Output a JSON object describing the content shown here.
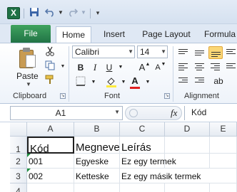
{
  "tabs": {
    "file": "File",
    "home": "Home",
    "insert": "Insert",
    "page_layout": "Page Layout",
    "formulas": "Formula"
  },
  "ribbon": {
    "paste_label": "Paste",
    "clipboard_label": "Clipboard",
    "font_name": "Calibri",
    "font_size": "14",
    "font_label": "Font",
    "alignment_label": "Alignment",
    "bold": "B",
    "italic": "I",
    "underline": "U",
    "grow_font": "A",
    "shrink_font": "A",
    "font_color": "A"
  },
  "formula_bar": {
    "name_box": "A1",
    "fx": "fx",
    "value": "Kód"
  },
  "sheet": {
    "columns": [
      "A",
      "B",
      "C",
      "D",
      "E"
    ],
    "rows": [
      {
        "num": "1",
        "cells": [
          "Kód",
          "Megnevezés",
          "Leírás",
          "",
          ""
        ]
      },
      {
        "num": "2",
        "cells": [
          "001",
          "Egyeske",
          "Ez egy termek",
          "",
          ""
        ]
      },
      {
        "num": "3",
        "cells": [
          "002",
          "Ketteske",
          "Ez egy másik termek",
          "",
          ""
        ]
      },
      {
        "num": "4",
        "cells": [
          "",
          "",
          "",
          "",
          ""
        ]
      }
    ]
  },
  "colors": {
    "file_tab": "#217346",
    "accent_selected": "#fbd776",
    "error_indicator": "#1e8e3e"
  }
}
